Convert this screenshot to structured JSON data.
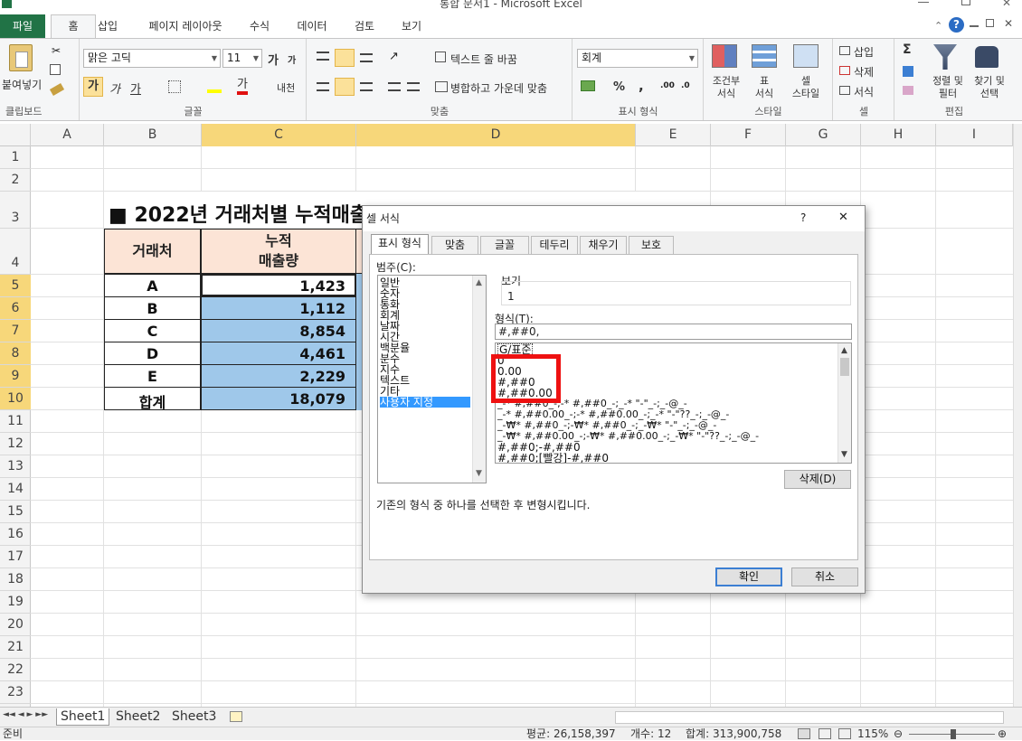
{
  "window": {
    "title": "통합 문서1  -  Microsoft Excel"
  },
  "ribbon_tabs": [
    {
      "label": "파일"
    },
    {
      "label": "홈"
    },
    {
      "label": "삽입"
    },
    {
      "label": "페이지 레이아웃"
    },
    {
      "label": "수식"
    },
    {
      "label": "데이터"
    },
    {
      "label": "검토"
    },
    {
      "label": "보기"
    }
  ],
  "ribbon": {
    "clipboard": {
      "label": "클립보드",
      "paste": "붙여넣기"
    },
    "font": {
      "label": "글꼴",
      "name": "맑은 고딕",
      "size": "11",
      "bold": "가",
      "italic": "가",
      "underline": "가",
      "grow": "가",
      "shrink": "가",
      "phonetic": "내천",
      "font_color": "가"
    },
    "align": {
      "label": "맞춤",
      "wrap": "텍스트 줄 바꿈",
      "merge": "병합하고 가운데 맞춤"
    },
    "number": {
      "label": "표시 형식",
      "format": "회계",
      "percent": "%",
      "comma": ","
    },
    "styles": {
      "label": "스타일",
      "conditional": "조건부",
      "conditional2": "서식",
      "table": "표",
      "table2": "서식",
      "cell": "셀",
      "cell2": "스타일"
    },
    "cells": {
      "label": "셀",
      "insert": "삽입",
      "delete": "삭제",
      "format": "서식"
    },
    "editing": {
      "label": "편집",
      "sigma": "Σ",
      "sort": "정렬 및",
      "sort2": "필터",
      "find": "찾기 및",
      "find2": "선택"
    }
  },
  "columns": [
    "A",
    "B",
    "C",
    "D",
    "E",
    "F",
    "G",
    "H",
    "I"
  ],
  "rows": [
    "1",
    "2",
    "3",
    "4",
    "5",
    "6",
    "7",
    "8",
    "9",
    "10",
    "11",
    "12",
    "13",
    "14",
    "15",
    "16",
    "17",
    "18",
    "19",
    "20",
    "21",
    "22",
    "23"
  ],
  "sheet": {
    "heading": "■ 2022년 거래처별 누적매출",
    "header_b": "거래처",
    "header_c1": "누적",
    "header_c2": "매출량",
    "data": [
      {
        "name": "A",
        "value": "1,423"
      },
      {
        "name": "B",
        "value": "1,112"
      },
      {
        "name": "C",
        "value": "8,854"
      },
      {
        "name": "D",
        "value": "4,461"
      },
      {
        "name": "E",
        "value": "2,229"
      },
      {
        "name": "합계",
        "value": "18,079"
      }
    ]
  },
  "sheet_tabs": [
    "Sheet1",
    "Sheet2",
    "Sheet3"
  ],
  "status": {
    "ready": "준비",
    "average": "평균:  26,158,397",
    "count": "개수: 12",
    "sum": "합계:  313,900,758",
    "zoom": "115%"
  },
  "dialog": {
    "title": "셀 서식",
    "help": "?",
    "close": "✕",
    "tabs": [
      "표시 형식",
      "맞춤",
      "글꼴",
      "테두리",
      "채우기",
      "보호"
    ],
    "category_label": "범주(C):",
    "categories": [
      "일반",
      "숫자",
      "통화",
      "회계",
      "날짜",
      "시간",
      "백분율",
      "분수",
      "지수",
      "텍스트",
      "기타",
      "사용자 지정"
    ],
    "preview_label": "보기",
    "preview_value": "1",
    "type_label": "형식(T):",
    "type_value": "#,##0,",
    "formats": [
      "G/표준",
      "0",
      "0.00",
      "#,##0",
      "#,##0.00",
      "_-* #,##0_-;-* #,##0_-;_-* \"-\"_-;_-@_-",
      "_-* #,##0.00_-;-* #,##0.00_-;_-* \"-\"??_-;_-@_-",
      "_-₩* #,##0_-;-₩* #,##0_-;_-₩* \"-\"_-;_-@_-",
      "_-₩* #,##0.00_-;-₩* #,##0.00_-;_-₩* \"-\"??_-;_-@_-",
      "#,##0;-#,##0",
      "#,##0;[빨강]-#,##0"
    ],
    "delete_button": "삭제(D)",
    "description": "기존의 형식 중 하나를 선택한 후 변형시킵니다.",
    "ok": "확인",
    "cancel": "취소"
  },
  "colors": {
    "accent": "#217346",
    "selected_header": "#f7d77a",
    "cell_fill": "#9fc8ea",
    "header_fill": "#fce4d6",
    "highlight": "#ee1111"
  }
}
